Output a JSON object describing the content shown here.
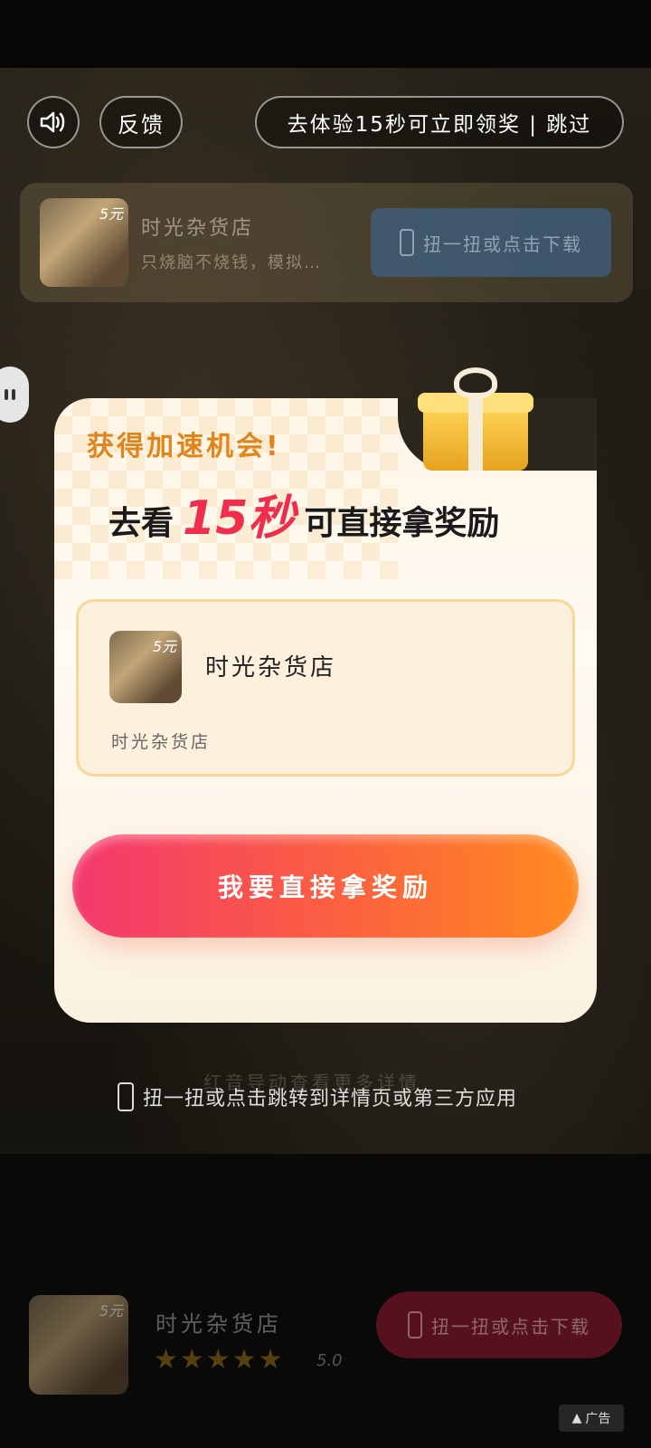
{
  "topbar": {
    "feedback_label": "反馈",
    "skip_label": "去体验15秒可立即领奖 | 跳过"
  },
  "banner": {
    "app_name": "时光杂货店",
    "description": "只烧脑不烧钱，模拟…",
    "download_label": "扭一扭或点击下载",
    "thumb_badge": "5元"
  },
  "modal": {
    "headline": "获得加速机会!",
    "main_prefix": "去看",
    "main_highlight": "15秒",
    "main_suffix": "可直接拿奖励",
    "app_card": {
      "title": "时光杂货店",
      "subtitle": "时光杂货店",
      "thumb_badge": "5元"
    },
    "cta_label": "我要直接拿奖励"
  },
  "faded_hint": "红音导动查看更多详情",
  "shake_hint": "扭一扭或点击跳转到详情页或第三方应用",
  "bottom_bar": {
    "app_name": "时光杂货店",
    "stars": "★★★★★",
    "rating": "5.0",
    "download_label": "扭一扭或点击下载",
    "thumb_badge": "5元"
  },
  "ad_tag": "广告",
  "colors": {
    "accent_orange": "#e0851c",
    "highlight_red": "#ee2e4c",
    "cta_start": "#f3386e",
    "cta_end": "#ff8a1f"
  }
}
